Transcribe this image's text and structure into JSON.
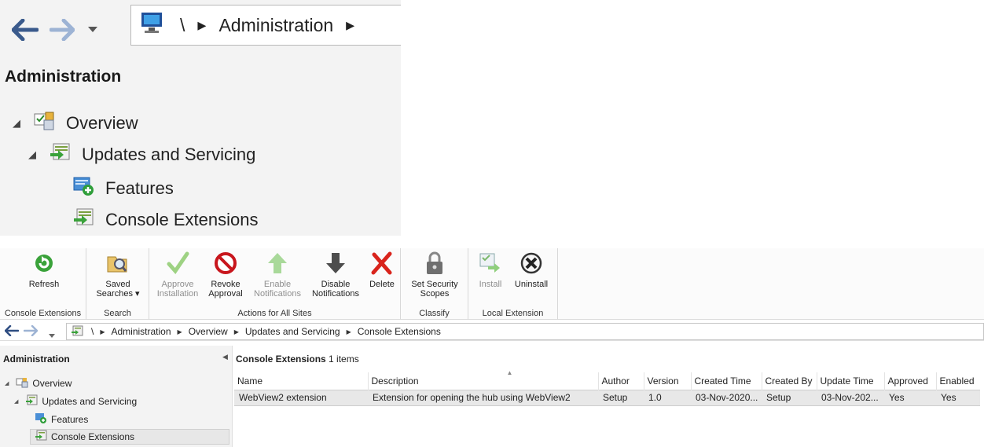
{
  "zoom": {
    "path_sep": "\\",
    "path_item": "Administration",
    "title": "Administration",
    "tree": [
      {
        "label": "Overview",
        "icon": "overview-icon"
      },
      {
        "label": "Updates and Servicing",
        "icon": "updates-servicing-icon"
      },
      {
        "label": "Features",
        "icon": "features-icon"
      },
      {
        "label": "Console Extensions",
        "icon": "console-extensions-icon"
      }
    ]
  },
  "ribbon": {
    "groups": [
      {
        "label": "Console Extensions"
      },
      {
        "label": "Search"
      },
      {
        "label": "Actions for All Sites"
      },
      {
        "label": "Classify"
      },
      {
        "label": "Local Extension"
      }
    ],
    "buttons": {
      "refresh": {
        "line1": "Refresh",
        "line2": ""
      },
      "saved_searches": {
        "line1": "Saved",
        "line2": "Searches ▾"
      },
      "approve": {
        "line1": "Approve",
        "line2": "Installation"
      },
      "revoke": {
        "line1": "Revoke",
        "line2": "Approval"
      },
      "enable": {
        "line1": "Enable",
        "line2": "Notifications"
      },
      "disable": {
        "line1": "Disable",
        "line2": "Notifications"
      },
      "delete": {
        "line1": "Delete",
        "line2": ""
      },
      "security": {
        "line1": "Set Security",
        "line2": "Scopes"
      },
      "install": {
        "line1": "Install",
        "line2": ""
      },
      "uninstall": {
        "line1": "Uninstall",
        "line2": ""
      }
    }
  },
  "address": {
    "sep": "\\",
    "crumbs": [
      "Administration",
      "Overview",
      "Updates and Servicing",
      "Console Extensions"
    ]
  },
  "nav": {
    "title": "Administration",
    "items": [
      "Overview",
      "Updates and Servicing",
      "Features",
      "Console Extensions"
    ]
  },
  "list": {
    "title": "Console Extensions",
    "count": "1 items",
    "columns": [
      "Name",
      "Description",
      "Author",
      "Version",
      "Created Time",
      "Created By",
      "Update Time",
      "Approved",
      "Enabled"
    ],
    "rows": [
      [
        "WebView2 extension",
        "Extension for opening the hub using WebView2",
        "Setup",
        "1.0",
        "03-Nov-2020...",
        "Setup",
        "03-Nov-202...",
        "Yes",
        "Yes"
      ]
    ]
  },
  "colors": {
    "accent_green": "#3aa23a",
    "delete_red": "#d9241c",
    "revoke_red": "#c8161d"
  }
}
